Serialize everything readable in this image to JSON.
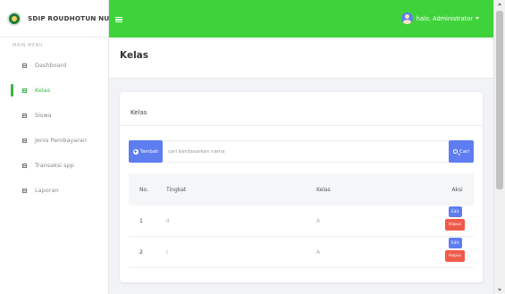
{
  "app": {
    "brand_name": "SDIP ROUDHOTUN NUR"
  },
  "sidebar": {
    "section_label": "MAIN MENU",
    "items": [
      {
        "label": "Dashboard",
        "icon": "dashboard-icon",
        "active": false
      },
      {
        "label": "Kelas",
        "icon": "table-icon",
        "active": true
      },
      {
        "label": "Siswa",
        "icon": "table-icon",
        "active": false
      },
      {
        "label": "Jenis Pembayaran",
        "icon": "table-icon",
        "active": false
      },
      {
        "label": "Transaksi spp",
        "icon": "table-icon",
        "active": false
      },
      {
        "label": "Laporan",
        "icon": "table-icon",
        "active": false
      }
    ]
  },
  "topbar": {
    "user_greeting": "halo, Administrator",
    "accent_color": "#3fd33b"
  },
  "page": {
    "title": "Kelas"
  },
  "card": {
    "title": "Kelas",
    "add_button_label": "Tambah",
    "search_placeholder": "cari berdasarkan nama",
    "search_button_label": "Cari",
    "table": {
      "headers": [
        "No.",
        "Tingkat",
        "Kelas",
        "Aksi"
      ],
      "rows": [
        {
          "no": "1",
          "tingkat": "II",
          "kelas": "A",
          "edit_label": "Edit",
          "delete_label": "Hapus"
        },
        {
          "no": "2",
          "tingkat": "I",
          "kelas": "A",
          "edit_label": "Edit",
          "delete_label": "Hapus"
        }
      ]
    }
  },
  "colors": {
    "primary": "#5e7df0",
    "danger": "#ef5a4a",
    "active": "#3bb54a"
  }
}
